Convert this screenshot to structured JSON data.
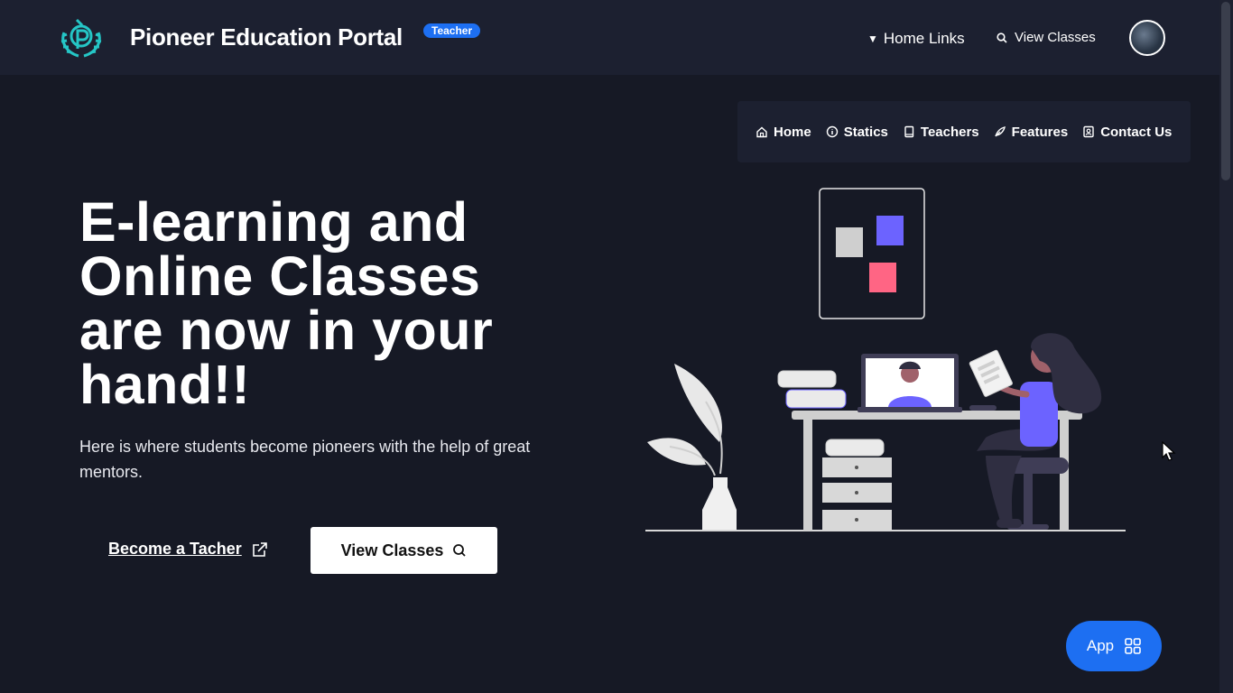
{
  "header": {
    "brand": "Pioneer Education Portal",
    "role_badge": "Teacher",
    "home_links": "Home Links",
    "view_classes": "View Classes"
  },
  "subnav": {
    "items": [
      {
        "label": "Home",
        "icon": "home-icon"
      },
      {
        "label": "Statics",
        "icon": "info-icon"
      },
      {
        "label": "Teachers",
        "icon": "book-icon"
      },
      {
        "label": "Features",
        "icon": "feather-icon"
      },
      {
        "label": "Contact Us",
        "icon": "contact-icon"
      }
    ]
  },
  "hero": {
    "title": "E-learning and Online Classes are now in your hand!!",
    "subtitle": "Here is where students become pioneers with the help of great mentors.",
    "become_teacher": "Become a Tacher",
    "view_classes_button": "View Classes"
  },
  "floating": {
    "app_label": "App"
  },
  "colors": {
    "background": "#161925",
    "topbar": "#1c2030",
    "accent": "#1d6ff2",
    "illustration_purple": "#6c63ff",
    "illustration_pink": "#ff6584"
  }
}
